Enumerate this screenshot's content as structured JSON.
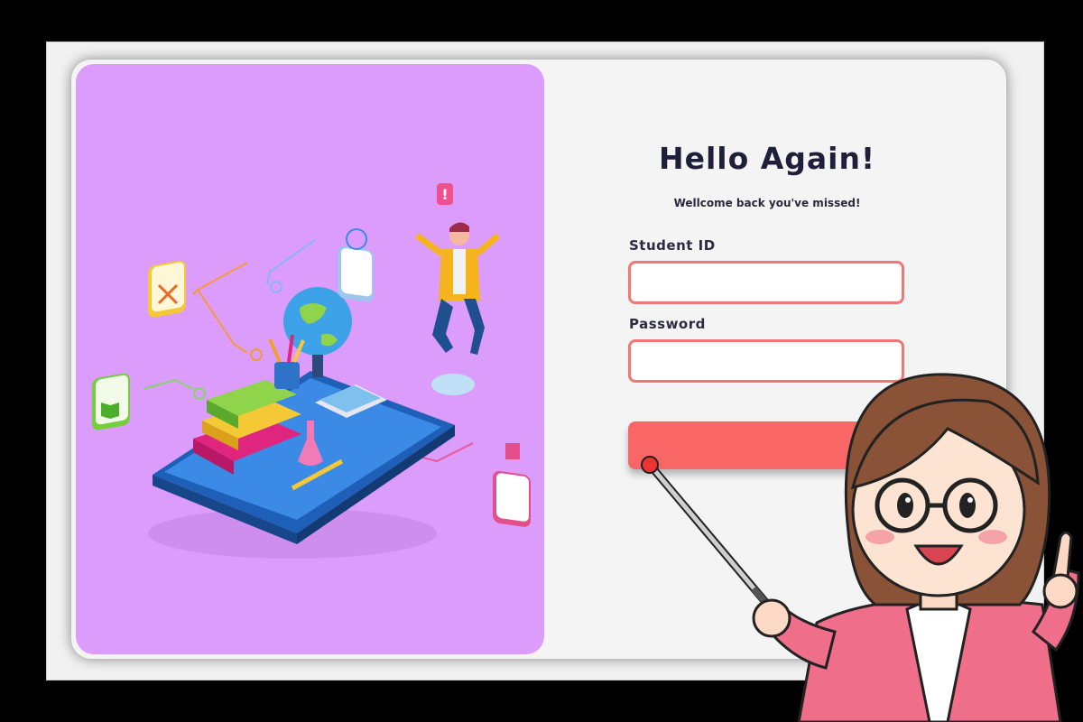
{
  "login": {
    "title": "Hello Again!",
    "subtitle": "Wellcome back you've missed!",
    "student_id_label": "Student ID",
    "student_id_value": "",
    "password_label": "Password",
    "password_value": "",
    "submit_label": ""
  },
  "icons": {
    "alert": "exclamation-icon",
    "globe": "globe-icon",
    "pencil": "pencil-ruler-icon",
    "book": "book-icon",
    "calculator": "calculator-icon"
  },
  "colors": {
    "hero_bg": "#dc9cfb",
    "input_border": "#f17774",
    "button": "#f86766",
    "title": "#1f1f3a"
  }
}
